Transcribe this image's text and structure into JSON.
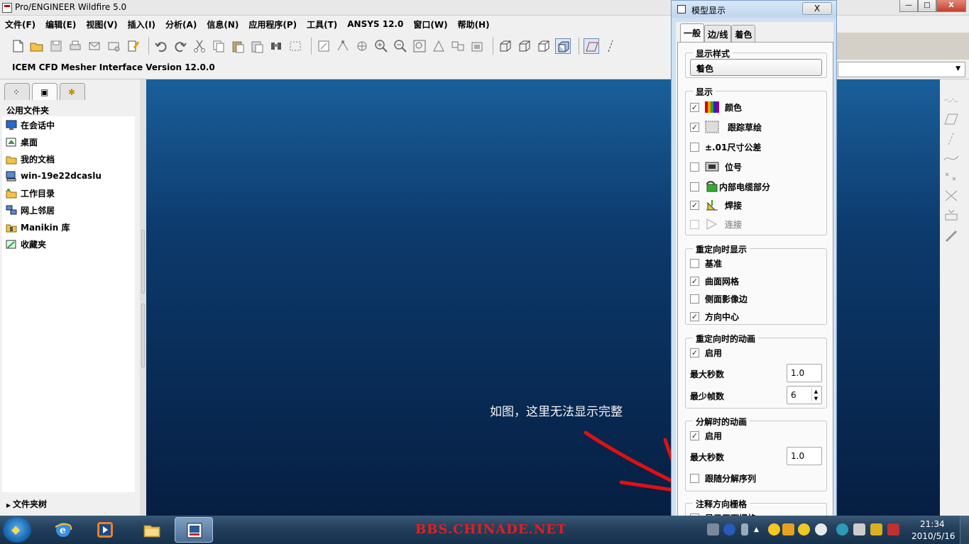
{
  "window": {
    "title": "Pro/ENGINEER Wildfire 5.0",
    "min": "—",
    "max": "□",
    "close": "X"
  },
  "menu": [
    "文件(F)",
    "编辑(E)",
    "视图(V)",
    "插入(I)",
    "分析(A)",
    "信息(N)",
    "应用程序(P)",
    "工具(T)",
    "ANSYS 12.0",
    "窗口(W)",
    "帮助(H)"
  ],
  "interface_label": "ICEM CFD Mesher Interface Version 12.0.0",
  "left_panel": {
    "folder_title": "公用文件夹",
    "items": [
      "在会话中",
      "桌面",
      "我的文档",
      "win-19e22dcaslu",
      "工作目录",
      "网上邻居",
      "Manikin 库",
      "收藏夹"
    ],
    "folder_tree": "文件夹树"
  },
  "graphics": {
    "note": "如图，这里无法显示完整"
  },
  "dialog": {
    "title": "模型显示",
    "close": "X",
    "tabs": [
      "一般",
      "边/线",
      "着色"
    ],
    "style_group": {
      "title": "显示样式",
      "value": "着色"
    },
    "display_group": {
      "title": "显示",
      "items": [
        {
          "label": "颜色",
          "checked": true
        },
        {
          "label": "跟踪草绘",
          "checked": true
        },
        {
          "label": "±.01尺寸公差",
          "checked": false
        },
        {
          "label": "位号",
          "checked": false
        },
        {
          "label": "内部电缆部分",
          "checked": false
        },
        {
          "label": "焊接",
          "checked": true
        },
        {
          "label": "连接",
          "checked": false
        }
      ]
    },
    "reorient_group": {
      "title": "重定向时显示",
      "items": [
        {
          "label": "基准",
          "checked": false
        },
        {
          "label": "曲面网格",
          "checked": true
        },
        {
          "label": "侧面影像边",
          "checked": false
        },
        {
          "label": "方向中心",
          "checked": true
        }
      ]
    },
    "reorient_anim_group": {
      "title": "重定向时的动画",
      "enable": {
        "label": "启用",
        "checked": true
      },
      "max_seconds": {
        "label": "最大秒数",
        "value": "1.0"
      },
      "min_frames": {
        "label": "最少帧数",
        "value": "6"
      }
    },
    "explode_anim_group": {
      "title": "分解时的动画",
      "enable": {
        "label": "启用",
        "checked": true
      },
      "max_seconds": {
        "label": "最大秒数",
        "value": "1.0"
      },
      "follow_sequence": {
        "label": "跟随分解序列",
        "checked": false
      }
    },
    "annotation_group": {
      "title": "注释方向栅格",
      "partial_item": "显示平面栅格"
    }
  },
  "taskbar": {
    "watermark": "BBS.CHINADE.NET",
    "time": "21:34",
    "date": "2010/5/16"
  },
  "colors": {
    "graphics_top": "#1a5f9a",
    "graphics_bottom": "#061e42",
    "annotation_arrow": "#e01010"
  }
}
